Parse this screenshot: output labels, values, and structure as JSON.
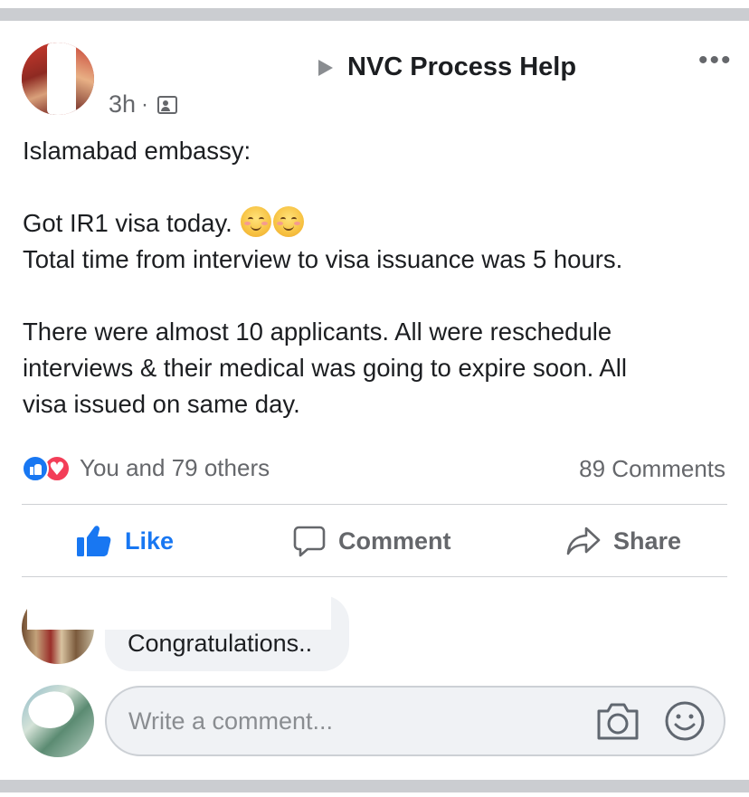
{
  "post": {
    "time": "3h",
    "separator": "·",
    "audience_icon": "group-icon",
    "group_name": "NVC Process Help",
    "more_label": "•••",
    "text": {
      "line1": "Islamabad embassy:",
      "line2": "Got IR1 visa today.",
      "emojis": [
        "smiling-face-icon",
        "smiling-face-icon"
      ],
      "line3": "Total time from interview to visa issuance was 5 hours.",
      "line4": "There were almost 10 applicants. All were reschedule",
      "line5": "interviews & their medical was going to expire soon. All",
      "line6": "visa issued on same day."
    },
    "reactions_text": "You and 79 others",
    "comments_count": "89 Comments"
  },
  "actions": {
    "like": "Like",
    "comment": "Comment",
    "share": "Share"
  },
  "comment": {
    "text": "Congratulations.."
  },
  "composer": {
    "placeholder": "Write a comment..."
  },
  "colors": {
    "accent": "#1877f2",
    "love": "#f33e58",
    "muted": "#65676b",
    "bubble": "#f0f2f5"
  }
}
